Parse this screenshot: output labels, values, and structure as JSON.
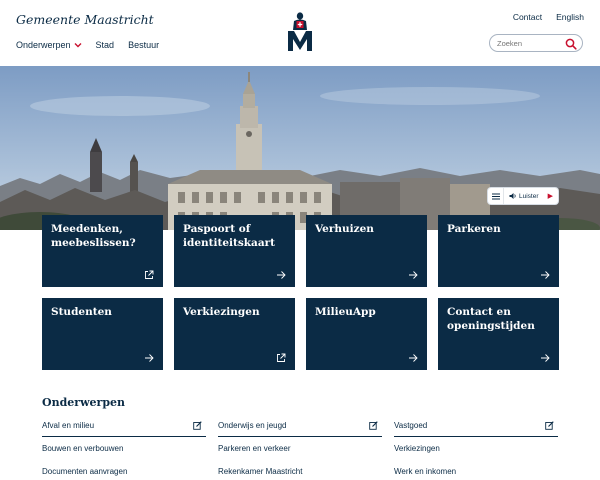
{
  "header": {
    "brand": "Gemeente Maastricht",
    "nav": [
      {
        "label": "Onderwerpen",
        "has_dropdown": true
      },
      {
        "label": "Stad"
      },
      {
        "label": "Bestuur"
      }
    ],
    "top_links": [
      "Contact",
      "English"
    ],
    "search": {
      "placeholder": "Zoeken"
    }
  },
  "hero": {
    "listen_label": "Luister"
  },
  "tiles": [
    {
      "title": "Meedenken, meebeslissen?",
      "icon": "external-link-icon"
    },
    {
      "title": "Paspoort of identiteitskaart",
      "icon": "arrow-right-icon"
    },
    {
      "title": "Verhuizen",
      "icon": "arrow-right-icon"
    },
    {
      "title": "Parkeren",
      "icon": "arrow-right-icon"
    },
    {
      "title": "Studenten",
      "icon": "arrow-right-icon"
    },
    {
      "title": "Verkiezingen",
      "icon": "external-link-icon"
    },
    {
      "title": "MilieuApp",
      "icon": "arrow-right-icon"
    },
    {
      "title": "Contact en openingstijden",
      "icon": "arrow-right-icon"
    }
  ],
  "topics": {
    "title": "Onderwerpen",
    "col1": [
      "Afval en milieu",
      "Bouwen en verbouwen",
      "Documenten aanvragen"
    ],
    "col2": [
      "Onderwijs en jeugd",
      "Parkeren en verkeer",
      "Rekenkamer Maastricht"
    ],
    "col3": [
      "Vastgoed",
      "Verkiezingen",
      "Werk en inkomen"
    ]
  },
  "colors": {
    "navy": "#0b2b45",
    "accent_red": "#c8102e"
  }
}
